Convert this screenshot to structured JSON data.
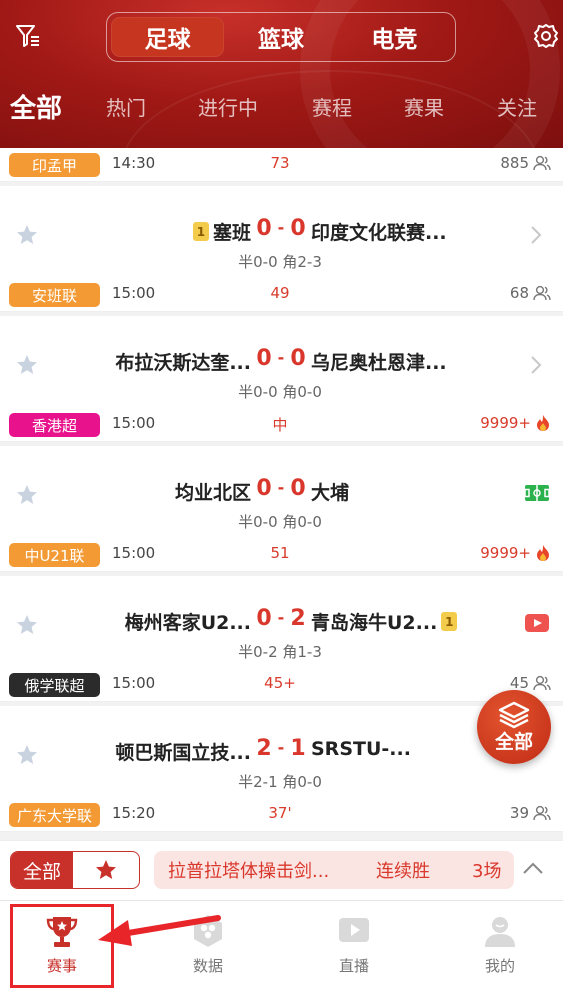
{
  "top_tabs": {
    "items": [
      "足球",
      "篮球",
      "电竞"
    ],
    "active": 0
  },
  "sub_tabs": {
    "items": [
      "全部",
      "热门",
      "进行中",
      "赛程",
      "赛果",
      "关注"
    ],
    "active": 0
  },
  "matches": [
    {
      "league": "印孟甲",
      "league_color": "#f39a34",
      "time": "14:30",
      "minute": "73",
      "count": "885",
      "count_type": "user",
      "home": "塞班",
      "home_badge": "1",
      "away": "印度文化联赛...",
      "home_score": "0",
      "away_score": "0",
      "sub": "半0-0 角2-3",
      "right": "chevron"
    },
    {
      "league": "安班联",
      "league_color": "#f39a34",
      "time": "15:00",
      "minute": "49",
      "count": "68",
      "count_type": "user",
      "home": "布拉沃斯达奎...",
      "away": "乌尼奥杜恩津...",
      "home_score": "0",
      "away_score": "0",
      "sub": "半0-0 角0-0",
      "right": "chevron"
    },
    {
      "league": "香港超",
      "league_color": "#e8138c",
      "time": "15:00",
      "minute": "中",
      "count": "9999+",
      "count_type": "hot",
      "home": "均业北区",
      "away": "大埔",
      "home_score": "0",
      "away_score": "0",
      "sub": "半0-0 角0-0",
      "right": "field"
    },
    {
      "league": "中U21联",
      "league_color": "#f39a34",
      "time": "15:00",
      "minute": "51",
      "count": "9999+",
      "count_type": "hot",
      "home": "梅州客家U2...",
      "away": "青岛海牛U2...",
      "away_badge": "1",
      "home_score": "0",
      "away_score": "2",
      "sub": "半0-2 角1-3",
      "right": "video"
    },
    {
      "league": "俄学联超",
      "league_color": "#2b2b2b",
      "time": "15:00",
      "minute": "45+",
      "count": "45",
      "count_type": "user",
      "home": "顿巴斯国立技...",
      "away": "SRSTU-...",
      "home_score": "2",
      "away_score": "1",
      "sub": "半2-1 角0-0",
      "right": "none"
    },
    {
      "league": "广东大学联",
      "league_color": "#f39a34",
      "time": "15:20",
      "minute": "37'",
      "count": "39",
      "count_type": "user"
    }
  ],
  "fab": {
    "label": "全部"
  },
  "filter_bar": {
    "all_label": "全部",
    "streak_team": "拉普拉塔体操击剑...",
    "streak_label": "连续胜",
    "streak_count": "3场"
  },
  "tab_bar": {
    "items": [
      {
        "label": "赛事",
        "icon": "trophy-icon"
      },
      {
        "label": "数据",
        "icon": "data-icon"
      },
      {
        "label": "直播",
        "icon": "play-icon"
      },
      {
        "label": "我的",
        "icon": "profile-icon"
      }
    ],
    "active": 0
  },
  "colors": {
    "brand": "#c8302a",
    "score": "#d9372c",
    "badge": "#f3cc4b"
  }
}
